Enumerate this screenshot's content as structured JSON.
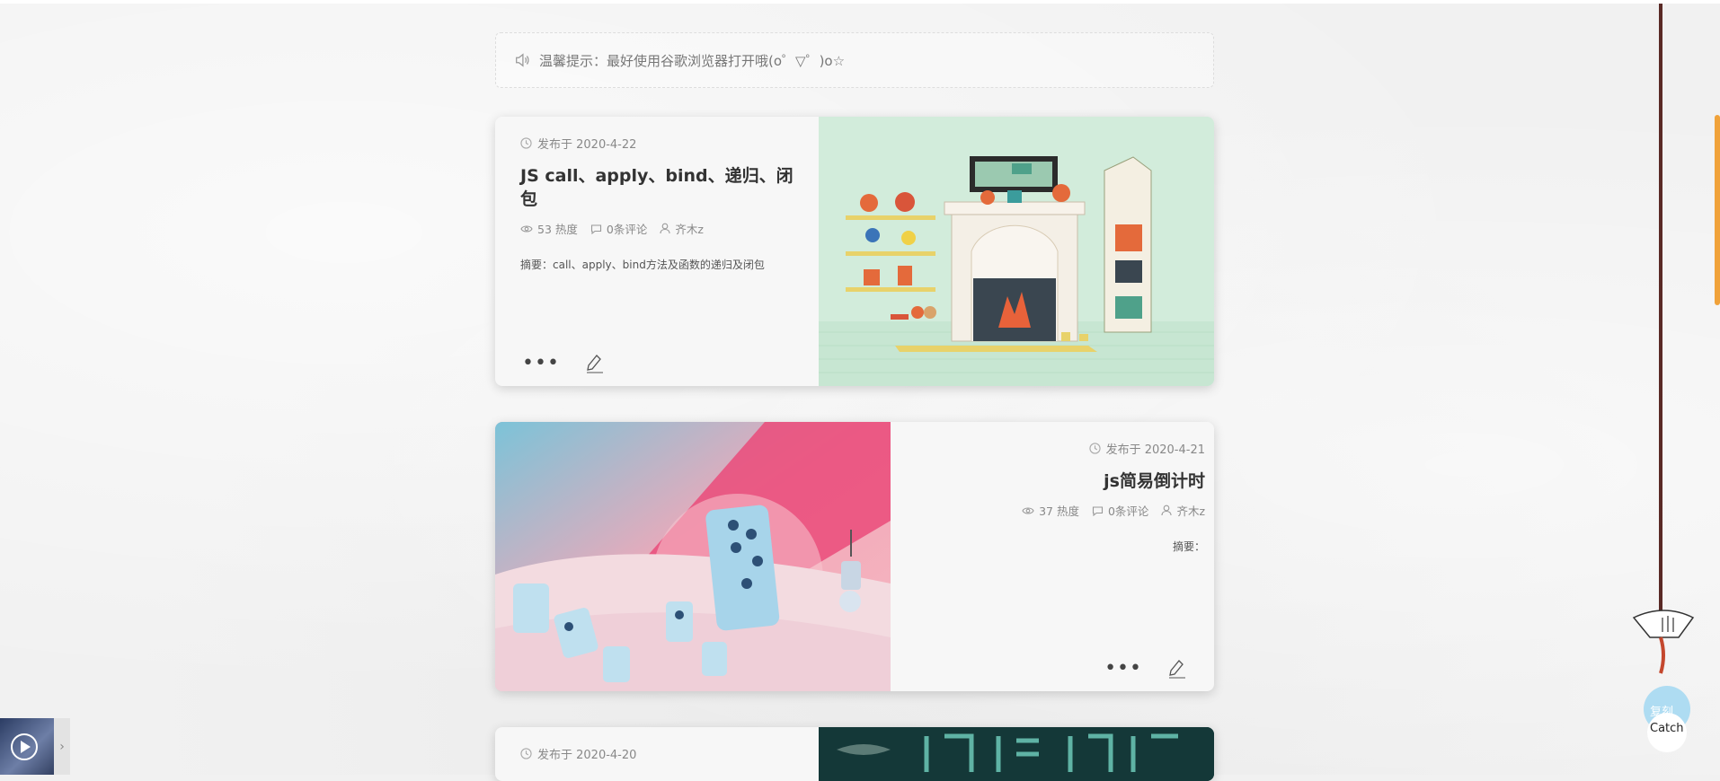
{
  "notice": {
    "text": "温馨提示：最好使用谷歌浏览器打开哦(o゜▽゜)o☆"
  },
  "posts": [
    {
      "date": "发布于 2020-4-22",
      "title": "JS call、apply、bind、递归、闭包",
      "views": "53 热度",
      "comments": "0条评论",
      "author": "齐木z",
      "summary": "摘要：call、apply、bind方法及函数的递归及闭包"
    },
    {
      "date": "发布于 2020-4-21",
      "title": "js简易倒计时",
      "views": "37 热度",
      "comments": "0条评论",
      "author": "齐木z",
      "summary": "摘要："
    },
    {
      "date": "发布于 2020-4-20"
    }
  ],
  "widget": {
    "catch_label": "Catch",
    "catch_copy": "复刻"
  },
  "colors": {
    "accent": "#f0a23a",
    "rope": "#5a2a26",
    "title": "#333333"
  },
  "icons": [
    "speaker-icon",
    "clock-icon",
    "eye-icon",
    "comment-icon",
    "user-icon",
    "more-icon",
    "edit-icon",
    "play-icon"
  ]
}
